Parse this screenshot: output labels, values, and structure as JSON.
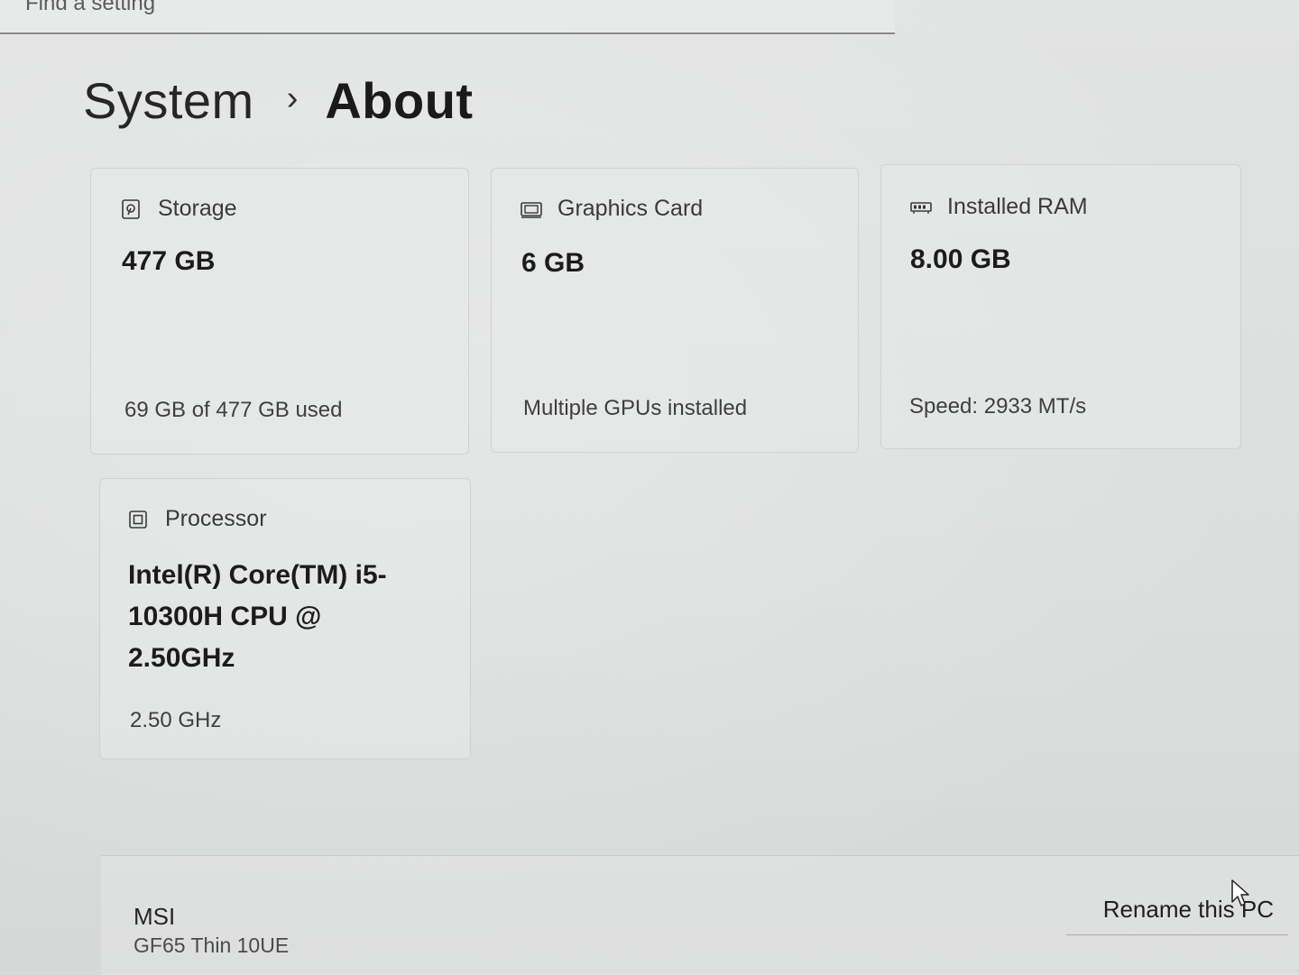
{
  "search": {
    "placeholder": "Find a setting"
  },
  "breadcrumb": {
    "parent": "System",
    "separator": "›",
    "current": "About"
  },
  "specs": {
    "storage": {
      "icon": "storage-icon",
      "label": "Storage",
      "value": "477 GB",
      "detail": "69 GB of 477 GB used"
    },
    "graphics": {
      "icon": "graphics-card-icon",
      "label": "Graphics Card",
      "value": "6 GB",
      "detail": "Multiple GPUs installed"
    },
    "ram": {
      "icon": "ram-icon",
      "label": "Installed RAM",
      "value": "8.00 GB",
      "detail": "Speed: 2933 MT/s"
    },
    "processor": {
      "icon": "processor-icon",
      "label": "Processor",
      "value": "Intel(R) Core(TM) i5-10300H CPU @ 2.50GHz",
      "detail": "2.50 GHz"
    }
  },
  "device": {
    "brand": "MSI",
    "model": "GF65 Thin 10UE",
    "rename_label": "Rename this PC"
  },
  "colors": {
    "background": "#dedfdf",
    "text_primary": "#1c1c1c",
    "text_secondary": "#3f3f3f"
  }
}
